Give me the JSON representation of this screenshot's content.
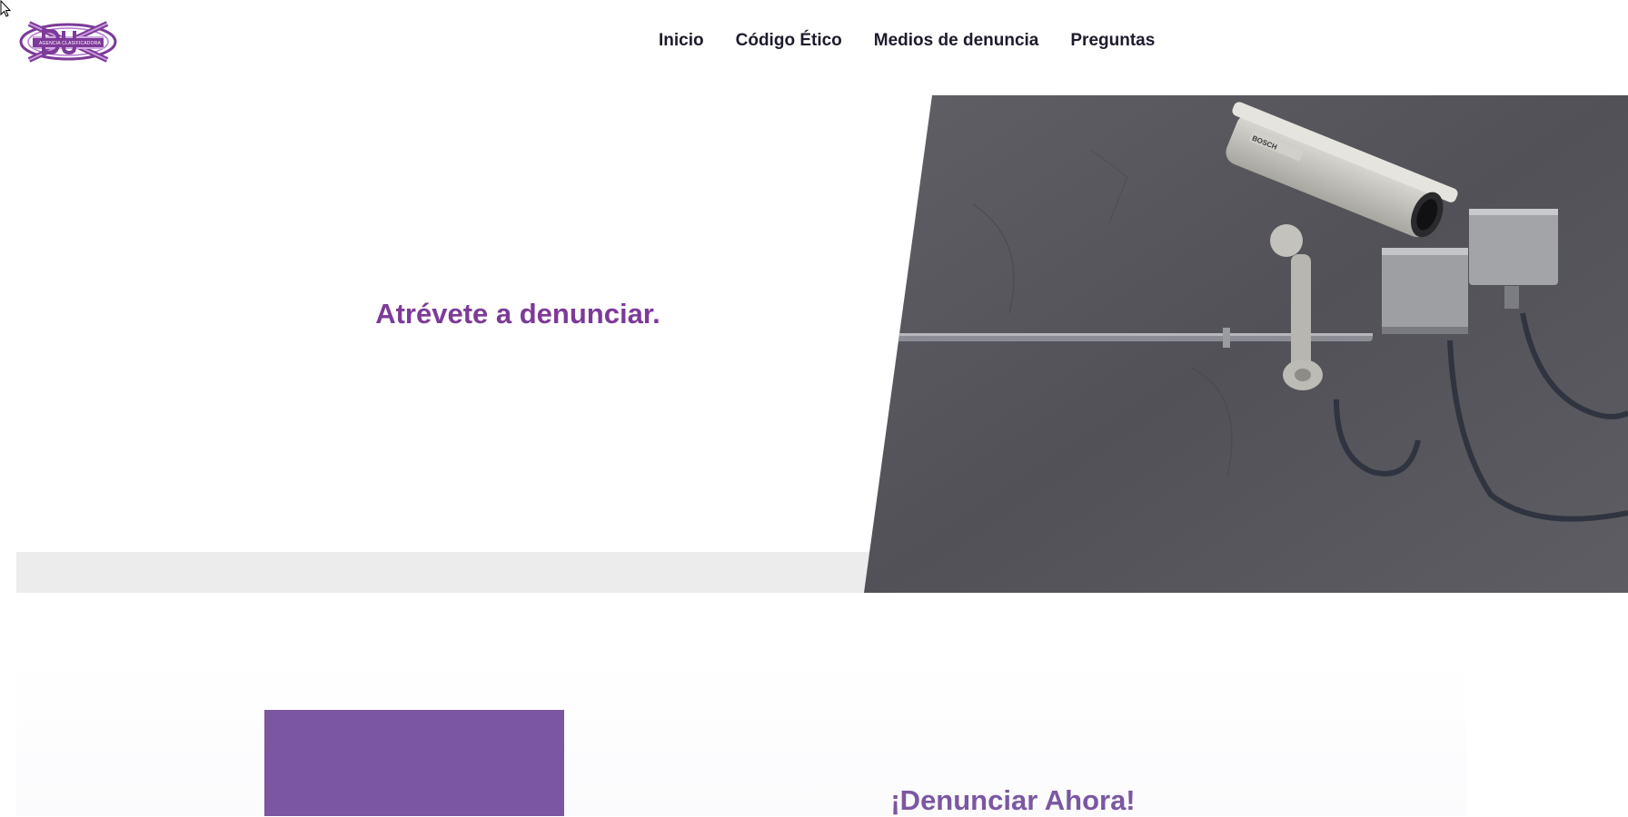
{
  "header": {
    "logo": {
      "icon": "dux-logo-icon",
      "caption": "AGENCIA CLASIFICADORA"
    },
    "nav": {
      "items": [
        {
          "label": "Inicio"
        },
        {
          "label": "Código Ético"
        },
        {
          "label": "Medios de denuncia"
        },
        {
          "label": "Preguntas"
        }
      ]
    }
  },
  "hero": {
    "title": "Atrévete a denunciar.",
    "image": {
      "icon": "security-camera-photo",
      "brand_text": "BOSCH"
    }
  },
  "cta": {
    "title": "¡Denunciar Ahora!"
  },
  "colors": {
    "brand_purple": "#7d3a98",
    "cta_purple": "#7b57a1",
    "nav_text": "#1f1b2e",
    "band_gray": "#ececec"
  }
}
